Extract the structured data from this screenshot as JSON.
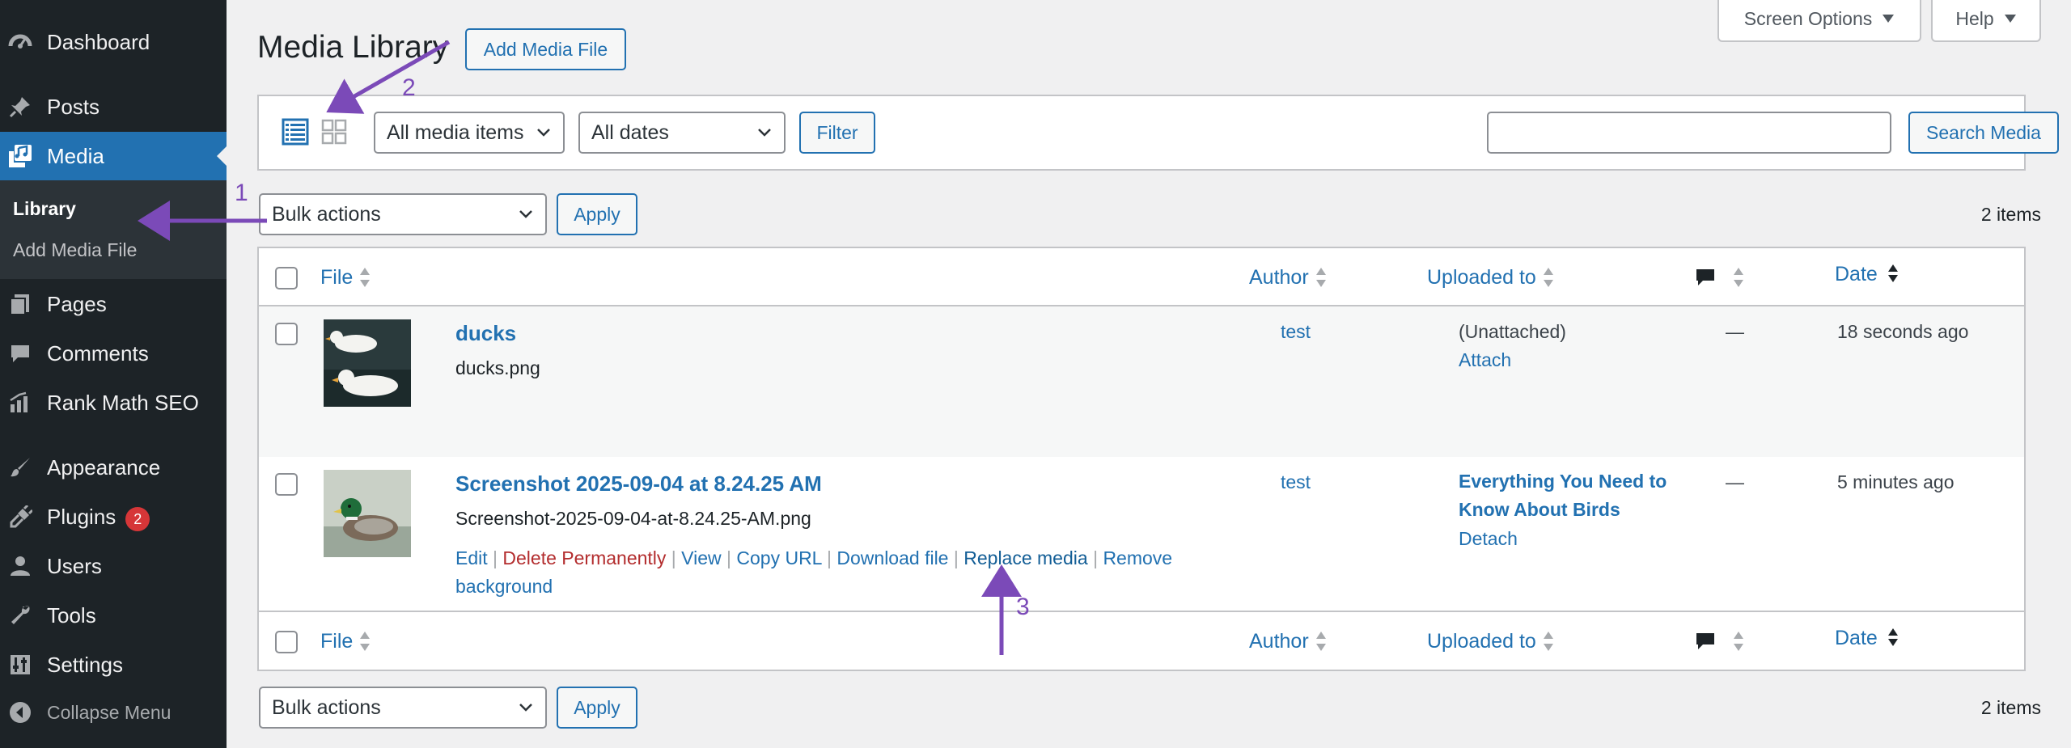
{
  "sidebar": {
    "items": [
      {
        "label": "Dashboard",
        "icon": "dashboard-icon"
      },
      {
        "label": "Posts",
        "icon": "pin-icon"
      },
      {
        "label": "Media",
        "icon": "media-icon"
      },
      {
        "label": "Pages",
        "icon": "pages-icon"
      },
      {
        "label": "Comments",
        "icon": "comment-icon"
      },
      {
        "label": "Rank Math SEO",
        "icon": "rank-math-icon"
      },
      {
        "label": "Appearance",
        "icon": "brush-icon"
      },
      {
        "label": "Plugins",
        "icon": "plug-icon",
        "badge": "2"
      },
      {
        "label": "Users",
        "icon": "user-icon"
      },
      {
        "label": "Tools",
        "icon": "wrench-icon"
      },
      {
        "label": "Settings",
        "icon": "settings-icon"
      }
    ],
    "submenu": {
      "library": "Library",
      "add_media": "Add Media File"
    },
    "collapse": "Collapse Menu"
  },
  "header": {
    "title": "Media Library",
    "add_button": "Add Media File",
    "screen_options": "Screen Options",
    "help": "Help"
  },
  "filters": {
    "media_type": "All media items",
    "dates": "All dates",
    "filter_button": "Filter",
    "search_value": "",
    "search_button": "Search Media"
  },
  "bulk": {
    "select": "Bulk actions",
    "apply": "Apply",
    "count": "2 items"
  },
  "table": {
    "columns": {
      "file": "File",
      "author": "Author",
      "uploaded_to": "Uploaded to",
      "date": "Date"
    },
    "rows": [
      {
        "title": "ducks",
        "filename": "ducks.png",
        "author": "test",
        "uploaded_status": "(Unattached)",
        "uploaded_action": "Attach",
        "comments": "—",
        "date": "18 seconds ago"
      },
      {
        "title": "Screenshot 2025-09-04 at 8.24.25 AM",
        "filename": "Screenshot-2025-09-04-at-8.24.25-AM.png",
        "author": "test",
        "uploaded_post": "Everything You Need to Know About Birds",
        "uploaded_action": "Detach",
        "comments": "—",
        "date": "5 minutes ago",
        "actions": {
          "edit": "Edit",
          "delete": "Delete Permanently",
          "view": "View",
          "copy_url": "Copy URL",
          "download": "Download file",
          "replace": "Replace media",
          "remove_bg": "Remove background",
          "separator": "|"
        }
      }
    ]
  },
  "annotations": {
    "one": "1",
    "two": "2",
    "three": "3"
  },
  "colors": {
    "accent": "#2271b1",
    "sidebar": "#1d2327",
    "annotation": "#7b4ab8",
    "danger": "#b32d2e",
    "badge": "#d63638"
  }
}
